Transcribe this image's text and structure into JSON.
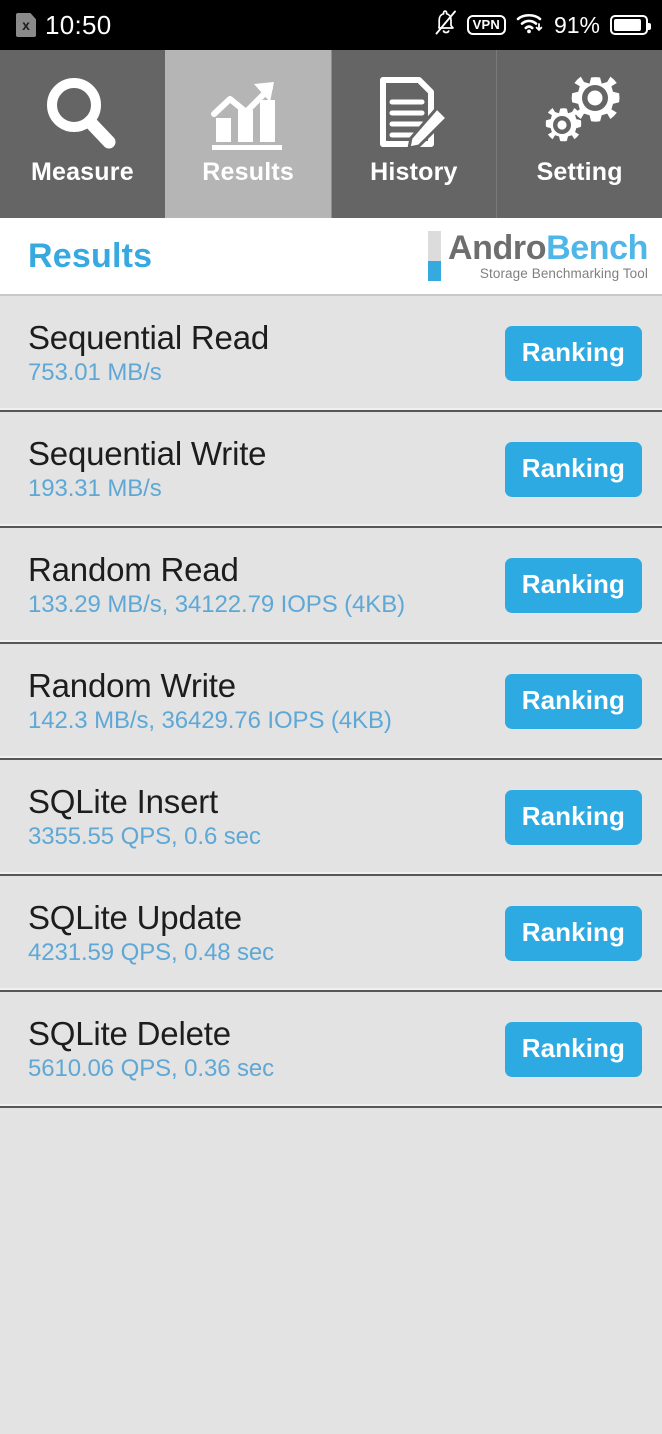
{
  "statusbar": {
    "sim_label": "x",
    "time": "10:50",
    "vpn_label": "VPN",
    "battery_percent": "91%",
    "icons": [
      "sim-card-off-icon",
      "notifications-off-icon",
      "vpn-icon",
      "wifi-icon",
      "battery-icon"
    ]
  },
  "tabs": [
    {
      "label": "Measure",
      "icon": "magnifier-icon",
      "active": false
    },
    {
      "label": "Results",
      "icon": "bar-chart-arrow-icon",
      "active": true
    },
    {
      "label": "History",
      "icon": "document-pencil-icon",
      "active": false
    },
    {
      "label": "Setting",
      "icon": "gears-icon",
      "active": false
    }
  ],
  "header": {
    "page_title": "Results",
    "logo_primary": "Andro",
    "logo_secondary": "Bench",
    "logo_tagline": "Storage Benchmarking Tool"
  },
  "colors": {
    "accent_blue": "#2daae2",
    "title_blue": "#36a9e1",
    "value_blue": "#5fa8d6",
    "tab_inactive": "#656565",
    "tab_active": "#b5b5b5",
    "list_bg": "#e3e3e3",
    "logo_gray": "#6e6e6e"
  },
  "results": {
    "ranking_label": "Ranking",
    "rows": [
      {
        "title": "Sequential Read",
        "value": "753.01 MB/s"
      },
      {
        "title": "Sequential Write",
        "value": "193.31 MB/s"
      },
      {
        "title": "Random Read",
        "value": "133.29 MB/s, 34122.79 IOPS (4KB)"
      },
      {
        "title": "Random Write",
        "value": "142.3 MB/s, 36429.76 IOPS (4KB)"
      },
      {
        "title": "SQLite Insert",
        "value": "3355.55 QPS, 0.6 sec"
      },
      {
        "title": "SQLite Update",
        "value": "4231.59 QPS, 0.48 sec"
      },
      {
        "title": "SQLite Delete",
        "value": "5610.06 QPS, 0.36 sec"
      }
    ]
  }
}
